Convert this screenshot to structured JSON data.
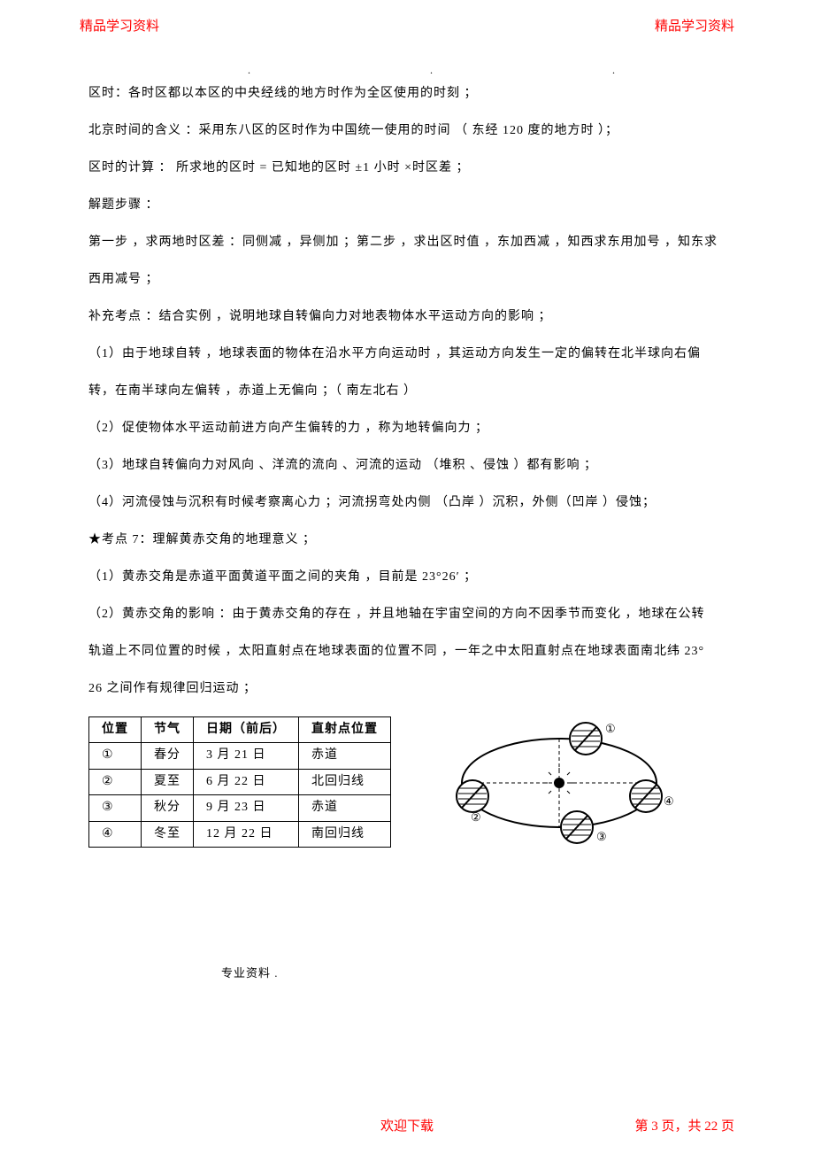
{
  "header": {
    "left": "精品学习资料",
    "right": "精品学习资料"
  },
  "top_dots": ".   .   .",
  "body": {
    "p1": "区时：各时区都以本区的中央经线的地方时作为全区使用的时刻  ；",
    "p2": "北京时间的含义  ：采用东八区的区时作为中国统一使用的时间  （ 东经 120 度的地方时 ）；",
    "p3": "区时的计算  ： 所求地的区时 = 已知地的区时 ±1 小时 ×时区差 ；",
    "p4": "解题步骤 ：",
    "p5": "第一步 ，求两地时区差 ：同侧减 ，异侧加 ；第二步 ，求出区时值 ，东加西减 ，知西求东用加号  ，知东求",
    "p6": "西用减号 ；",
    "p7": "补充考点 ：结合实例 ，说明地球自转偏向力对地表物体水平运动方向的影响  ；",
    "p8": "（1）由于地球自转  ，地球表面的物体在沿水平方向运动时  ，其运动方向发生一定的偏转在北半球向右偏",
    "p9": "转，在南半球向左偏转  ，赤道上无偏向  ；（ 南左北右 ）",
    "p10": "（2）促使物体水平运动前进方向产生偏转的力  ，称为地转偏向力  ；",
    "p11": "（3）地球自转偏向力对风向  、洋流的流向 、河流的运动 （堆积 、侵蚀 ）都有影响 ；",
    "p12": "（4）河流侵蚀与沉积有时候考察离心力  ；河流拐弯处内侧 （凸岸 ）沉积，外侧（凹岸 ）侵蚀；",
    "p13": "★考点 7：理解黄赤交角的地理意义  ；",
    "p14": "（1）黄赤交角是赤道平面黄道平面之间的夹角  ，目前是 23°26′ ；",
    "p15": "（2）黄赤交角的影响  ：由于黄赤交角的存在  ，并且地轴在宇宙空间的方向不因季节而变化  ，地球在公转",
    "p16": "轨道上不同位置的时候  ，太阳直射点在地球表面的位置不同  ，一年之中太阳直射点在地球表面南北纬  23°",
    "p17": "26 之间作有规律回归运动  ；"
  },
  "table": {
    "headers": [
      "位置",
      "节气",
      "日期（前后）",
      "直射点位置"
    ],
    "rows": [
      [
        "①",
        "春分",
        "3 月 21 日",
        "赤道"
      ],
      [
        "②",
        "夏至",
        "6 月 22 日",
        "北回归线"
      ],
      [
        "③",
        "秋分",
        "9 月 23 日",
        "赤道"
      ],
      [
        "④",
        "冬至",
        "12 月 22 日",
        "南回归线"
      ]
    ]
  },
  "figure": {
    "labels": {
      "top": "①",
      "left": "②",
      "bottom": "③",
      "right": "④"
    }
  },
  "footnote": "专业资料 .",
  "footer": {
    "center": "欢迎下载",
    "right_prefix": "第 ",
    "right_page": "3",
    "right_mid": " 页，共 ",
    "right_total": "22",
    "right_suffix": " 页"
  }
}
